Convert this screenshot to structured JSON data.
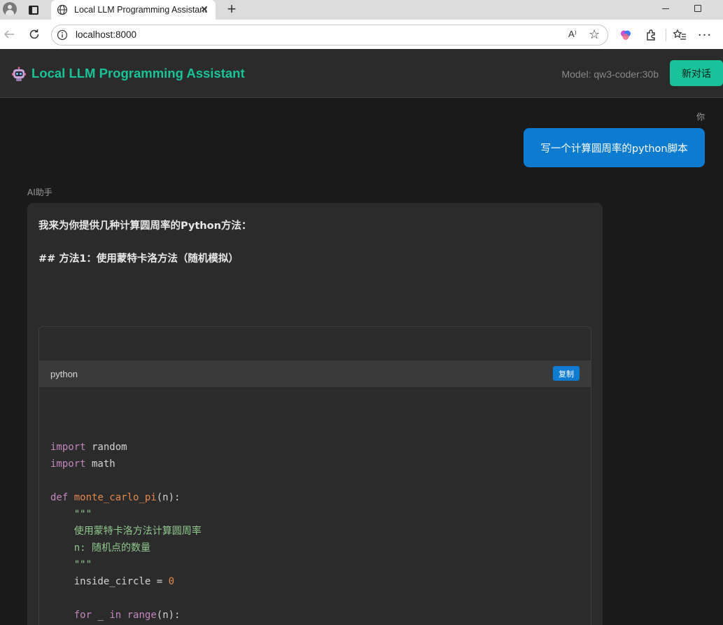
{
  "browser": {
    "tab_title": "Local LLM Programming Assistant",
    "tab_close": "✕",
    "new_tab": "+",
    "url": "localhost:8000",
    "read_aloud": "A⁾"
  },
  "app": {
    "title": "Local LLM Programming Assistant",
    "model_label": "Model: qw3-coder:30b",
    "new_chat_label": "新对话",
    "accent_color": "#19c39a",
    "user_bubble_color": "#0c7bd0"
  },
  "chat": {
    "user": {
      "name": "你",
      "message": "写一个计算圆周率的python脚本"
    },
    "assistant": {
      "name": "AI助手",
      "line1": "我来为你提供几种计算圆周率的Python方法：",
      "line2": "## 方法1：使用蒙特卡洛方法（随机模拟）",
      "code_block": {
        "language": "python",
        "copy_label": "复制",
        "lines": [
          [
            [
              "kw",
              "import"
            ],
            [
              "p",
              " random"
            ]
          ],
          [
            [
              "kw",
              "import"
            ],
            [
              "p",
              " math"
            ]
          ],
          [],
          [
            [
              "kw",
              "def"
            ],
            [
              "p",
              " "
            ],
            [
              "fn",
              "monte_carlo_pi"
            ],
            [
              "p",
              "(n):"
            ]
          ],
          [
            [
              "cm",
              "    \"\"\""
            ]
          ],
          [
            [
              "cm",
              "    使用蒙特卡洛方法计算圆周率"
            ]
          ],
          [
            [
              "cm",
              "    n: 随机点的数量"
            ]
          ],
          [
            [
              "cm",
              "    \"\"\""
            ]
          ],
          [
            [
              "p",
              "    inside_circle = "
            ],
            [
              "num",
              "0"
            ]
          ],
          [],
          [
            [
              "p",
              "    "
            ],
            [
              "kw",
              "for"
            ],
            [
              "p",
              " _ "
            ],
            [
              "kw",
              "in"
            ],
            [
              "p",
              " "
            ],
            [
              "bi",
              "range"
            ],
            [
              "p",
              "(n):"
            ]
          ]
        ]
      }
    }
  }
}
